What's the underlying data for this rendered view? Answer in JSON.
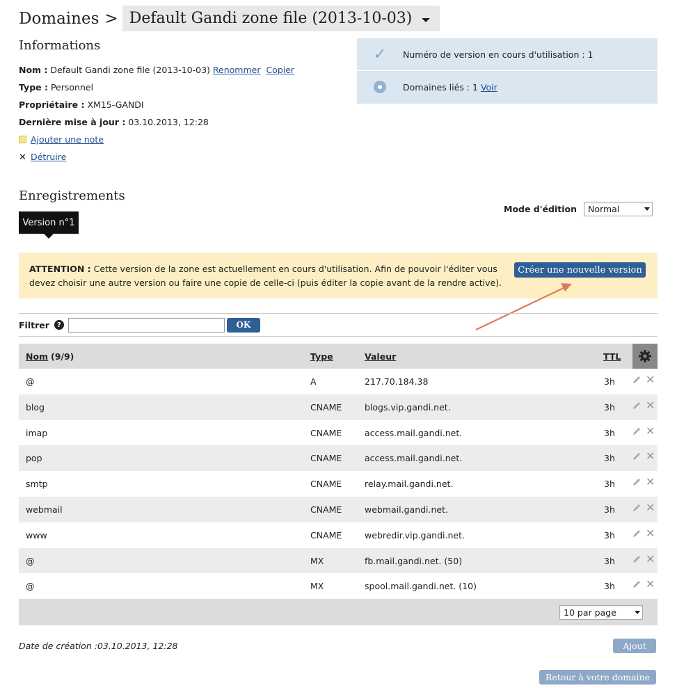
{
  "header": {
    "breadcrumb_root": "Domaines",
    "separator": ">",
    "zone_name": "Default Gandi zone file (2013-10-03)"
  },
  "informations": {
    "title": "Informations",
    "nom_label": "Nom :",
    "nom_value": "Default Gandi zone file (2013-10-03)",
    "rename_link": "Renommer",
    "copy_link": "Copier",
    "type_label": "Type :",
    "type_value": "Personnel",
    "owner_label": "Propriétaire :",
    "owner_value": "XM15-GANDI",
    "updated_label": "Dernière mise à jour :",
    "updated_value": "03.10.2013, 12:28",
    "add_note": "Ajouter une note",
    "destroy": "Détruire"
  },
  "status": {
    "version_text": "Numéro de version en cours d'utilisation : 1",
    "linked_text": "Domaines liés : 1",
    "linked_link": "Voir"
  },
  "records": {
    "title": "Enregistrements",
    "version_tab": "Version n°1",
    "mode_label": "Mode d'édition",
    "mode_value": "Normal"
  },
  "attention": {
    "label": "ATTENTION :",
    "text": "Cette version de la zone est actuellement en cours d'utilisation. Afin de pouvoir l'éditer vous devez choisir une autre version ou faire une copie de celle-ci (puis éditer la copie avant de la rendre active).",
    "button": "Créer une nouvelle version"
  },
  "filter": {
    "label": "Filtrer",
    "help": "?",
    "value": "",
    "ok": "OK"
  },
  "table": {
    "headers": {
      "nom": "Nom",
      "count": "(9/9)",
      "type": "Type",
      "valeur": "Valeur",
      "ttl": "TTL"
    },
    "rows": [
      {
        "nom": "@",
        "type": "A",
        "valeur": "217.70.184.38",
        "ttl": "3h"
      },
      {
        "nom": "blog",
        "type": "CNAME",
        "valeur": "blogs.vip.gandi.net.",
        "ttl": "3h"
      },
      {
        "nom": "imap",
        "type": "CNAME",
        "valeur": "access.mail.gandi.net.",
        "ttl": "3h"
      },
      {
        "nom": "pop",
        "type": "CNAME",
        "valeur": "access.mail.gandi.net.",
        "ttl": "3h"
      },
      {
        "nom": "smtp",
        "type": "CNAME",
        "valeur": "relay.mail.gandi.net.",
        "ttl": "3h"
      },
      {
        "nom": "webmail",
        "type": "CNAME",
        "valeur": "webmail.gandi.net.",
        "ttl": "3h"
      },
      {
        "nom": "www",
        "type": "CNAME",
        "valeur": "webredir.vip.gandi.net.",
        "ttl": "3h"
      },
      {
        "nom": "@",
        "type": "MX",
        "valeur": "fb.mail.gandi.net. (50)",
        "ttl": "3h"
      },
      {
        "nom": "@",
        "type": "MX",
        "valeur": "spool.mail.gandi.net. (10)",
        "ttl": "3h"
      }
    ],
    "per_page": "10 par page"
  },
  "footer": {
    "created": "Date de création :03.10.2013, 12:28",
    "add_button": "Ajout",
    "back_button": "Retour à votre domaine"
  },
  "colors": {
    "accent": "#2f5f95",
    "warning_bg": "#fdeec4",
    "status_bg": "#dae7f0",
    "arrow": "#e07a5a"
  }
}
